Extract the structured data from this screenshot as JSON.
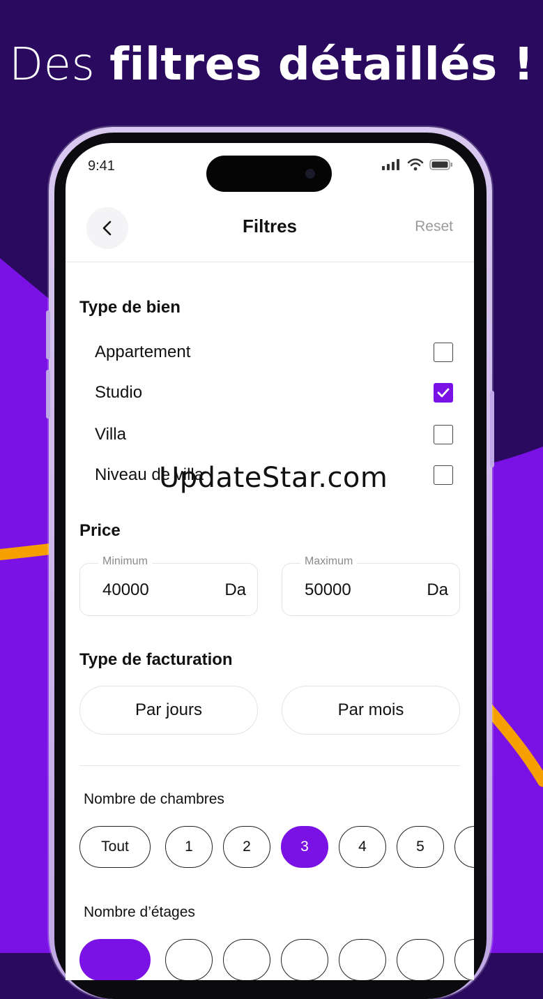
{
  "headline": {
    "light": "Des",
    "bold": "filtres détaillés !"
  },
  "status": {
    "time": "9:41"
  },
  "nav": {
    "title": "Filtres",
    "reset_label": "Reset"
  },
  "property_type": {
    "title": "Type de bien",
    "items": [
      {
        "label": "Appartement",
        "checked": false
      },
      {
        "label": "Studio",
        "checked": true
      },
      {
        "label": "Villa",
        "checked": false
      },
      {
        "label": "Niveau de villa",
        "checked": false
      }
    ]
  },
  "price": {
    "title": "Price",
    "min": {
      "caption": "Minimum",
      "value": "40000",
      "unit": "Da"
    },
    "max": {
      "caption": "Maximum",
      "value": "50000",
      "unit": "Da"
    }
  },
  "billing": {
    "title": "Type de facturation",
    "options": [
      "Par jours",
      "Par mois"
    ]
  },
  "rooms": {
    "title": "Nombre de chambres",
    "options": [
      "Tout",
      "1",
      "2",
      "3",
      "4",
      "5"
    ],
    "selected": "3"
  },
  "floors": {
    "title": "Nombre d’étages"
  },
  "watermark": "UpdateStar.com",
  "colors": {
    "accent": "#7a12e6",
    "background_dark": "#2a0a5e",
    "background_purple": "#7a12e6",
    "orange": "#f5a000"
  }
}
